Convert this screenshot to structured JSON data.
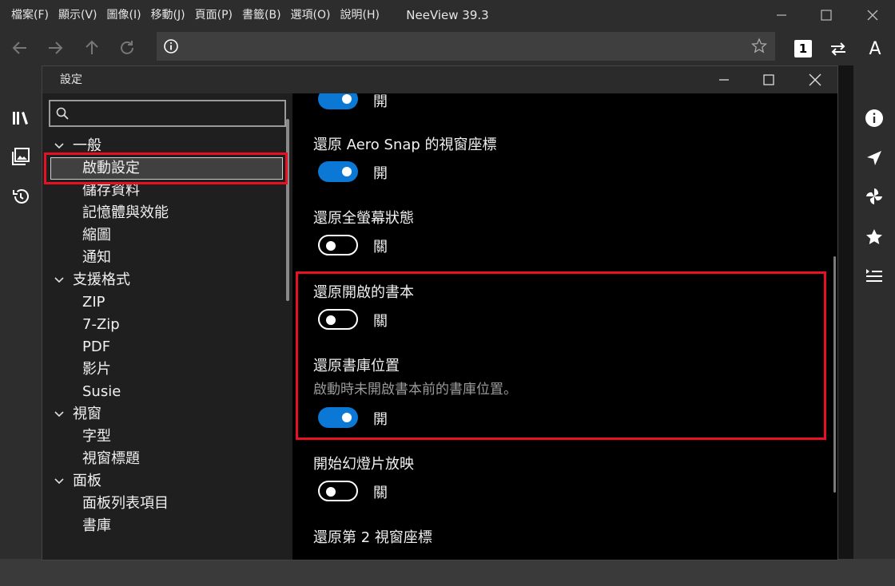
{
  "app": {
    "title": "NeeView 39.3",
    "menu": [
      "檔案(F)",
      "顯示(V)",
      "圖像(I)",
      "移動(J)",
      "頁面(P)",
      "書籤(B)",
      "選項(O)",
      "說明(H)"
    ]
  },
  "toolbar": {
    "page_mode": "1",
    "font_size_label": "A"
  },
  "settings_dialog": {
    "title": "設定",
    "search_placeholder": "",
    "tree": [
      {
        "label": "一般",
        "level": "category"
      },
      {
        "label": "啟動設定",
        "level": "sub",
        "selected": true
      },
      {
        "label": "儲存資料",
        "level": "sub"
      },
      {
        "label": "記憶體與效能",
        "level": "sub"
      },
      {
        "label": "縮圖",
        "level": "sub"
      },
      {
        "label": "通知",
        "level": "sub"
      },
      {
        "label": "支援格式",
        "level": "category"
      },
      {
        "label": "ZIP",
        "level": "sub"
      },
      {
        "label": "7-Zip",
        "level": "sub"
      },
      {
        "label": "PDF",
        "level": "sub"
      },
      {
        "label": "影片",
        "level": "sub"
      },
      {
        "label": "Susie",
        "level": "sub"
      },
      {
        "label": "視窗",
        "level": "category"
      },
      {
        "label": "字型",
        "level": "sub"
      },
      {
        "label": "視窗標題",
        "level": "sub"
      },
      {
        "label": "面板",
        "level": "category"
      },
      {
        "label": "面板列表項目",
        "level": "sub"
      },
      {
        "label": "書庫",
        "level": "sub"
      }
    ],
    "settings": [
      {
        "label": "",
        "state": "on",
        "state_text": "開"
      },
      {
        "label": "還原 Aero Snap 的視窗座標",
        "state": "on",
        "state_text": "開"
      },
      {
        "label": "還原全螢幕狀態",
        "state": "off",
        "state_text": "關"
      },
      {
        "label": "還原開啟的書本",
        "state": "off",
        "state_text": "關"
      },
      {
        "label": "還原書庫位置",
        "description": "啟動時未開啟書本前的書庫位置。",
        "state": "on",
        "state_text": "開"
      },
      {
        "label": "開始幻燈片放映",
        "state": "off",
        "state_text": "關"
      },
      {
        "label": "還原第 2 視窗座標"
      }
    ]
  },
  "colors": {
    "accent": "#0a78d4",
    "highlight_box": "#e81123"
  }
}
